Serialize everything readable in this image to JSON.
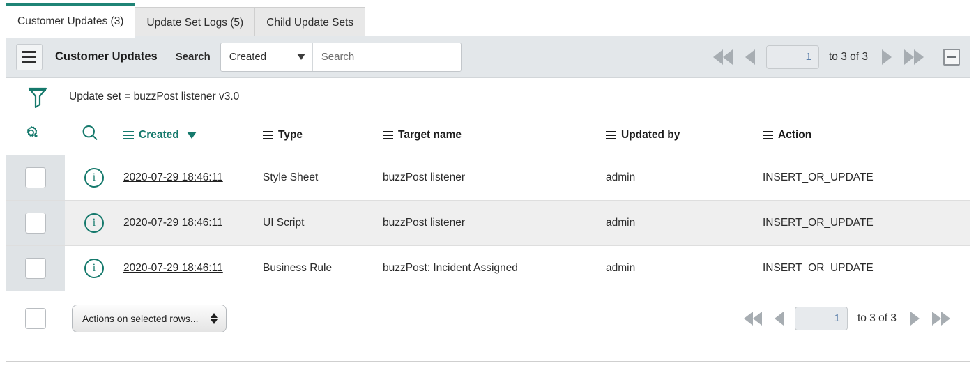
{
  "tabs": [
    {
      "label": "Customer Updates (3)",
      "active": true
    },
    {
      "label": "Update Set Logs (5)",
      "active": false
    },
    {
      "label": "Child Update Sets",
      "active": false
    }
  ],
  "toolbar": {
    "menu_icon": "hamburger-icon",
    "list_title": "Customer Updates",
    "search_label": "Search",
    "search_field_value": "Created",
    "search_field_caret": "chevron-down-icon",
    "search_input_value": "",
    "search_input_placeholder": "Search",
    "collapse_icon": "minus-square-icon"
  },
  "pagination": {
    "first_icon": "double-left-arrow-icon",
    "prev_icon": "left-arrow-icon",
    "page_value": "1",
    "range_text": "to 3 of 3",
    "next_icon": "right-arrow-icon",
    "last_icon": "double-right-arrow-icon"
  },
  "filter": {
    "icon": "funnel-icon",
    "text": "Update set = buzzPost listener v3.0"
  },
  "table": {
    "gear_icon": "gear-icon",
    "search_icon": "search-icon",
    "columns": [
      {
        "label": "Created",
        "sorted": true,
        "sort_dir": "desc"
      },
      {
        "label": "Type",
        "sorted": false
      },
      {
        "label": "Target name",
        "sorted": false
      },
      {
        "label": "Updated by",
        "sorted": false
      },
      {
        "label": "Action",
        "sorted": false
      }
    ],
    "rows": [
      {
        "created": "2020-07-29 18:46:11",
        "type": "Style Sheet",
        "target_name": "buzzPost listener",
        "updated_by": "admin",
        "action": "INSERT_OR_UPDATE"
      },
      {
        "created": "2020-07-29 18:46:11",
        "type": "UI Script",
        "target_name": "buzzPost listener",
        "updated_by": "admin",
        "action": "INSERT_OR_UPDATE"
      },
      {
        "created": "2020-07-29 18:46:11",
        "type": "Business Rule",
        "target_name": "buzzPost: Incident Assigned",
        "updated_by": "admin",
        "action": "INSERT_OR_UPDATE"
      }
    ]
  },
  "footer": {
    "actions_label": "Actions on selected rows...",
    "spinner_icon": "up-down-arrows-icon"
  },
  "colors": {
    "accent": "#15796c",
    "tab_active_border": "#1f8476",
    "toolbar_bg": "#e3e7ea",
    "row_alt_bg": "#efefef",
    "checkbox_col_bg": "#dfe3e6",
    "page_number": "#5b7faa"
  }
}
